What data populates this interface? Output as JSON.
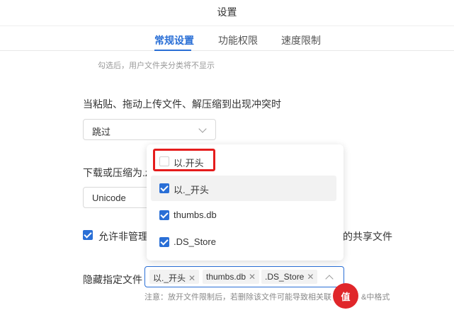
{
  "window": {
    "title": "设置"
  },
  "tabs": [
    {
      "label": "常规设置",
      "active": true
    },
    {
      "label": "功能权限",
      "active": false
    },
    {
      "label": "速度限制",
      "active": false
    }
  ],
  "hint_text": "勾选后，用户文件夹分类将不显示",
  "conflict": {
    "label": "当粘贴、拖动上传文件、解压缩到出现冲突时",
    "value": "跳过"
  },
  "encoding": {
    "label": "下载或压缩为.z",
    "value": "Unicode"
  },
  "allow_row": {
    "label_left": "允许非管理",
    "label_right": "的共享文件",
    "checked": true
  },
  "hide_files": {
    "label": "隐藏指定文件",
    "tags": [
      "以._开头",
      "thumbs.db",
      ".DS_Store"
    ],
    "note": "注意：放开文件限制后，若删除该文件可能导致相关联",
    "note_tail": "&中格式"
  },
  "dropdown": {
    "options": [
      {
        "label": "以.开头",
        "checked": false
      },
      {
        "label": "以._开头",
        "checked": true
      },
      {
        "label": "thumbs.db",
        "checked": true
      },
      {
        "label": ".DS_Store",
        "checked": true
      }
    ]
  },
  "icons": {
    "checkbox": "checkmark-icon",
    "chevron": "chevron-down-icon",
    "close": "close-icon",
    "logo": "logo-icon"
  },
  "watermark": {
    "text": "值"
  },
  "colors": {
    "accent": "#2a6fd6",
    "highlight": "#e51c1c",
    "watermark": "#e0262a"
  }
}
